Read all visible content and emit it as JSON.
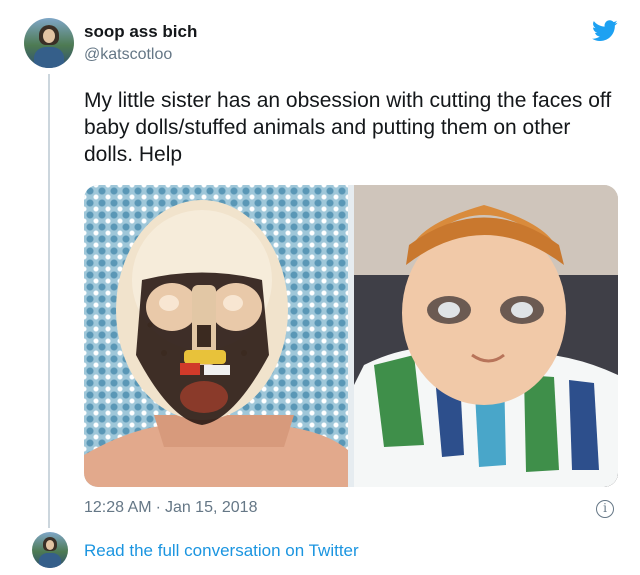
{
  "tweet": {
    "author": {
      "display_name": "soop ass bich",
      "handle": "@katscotloo",
      "avatar_icon": "user-avatar"
    },
    "text": "My little sister has an obsession with cutting the faces off baby dolls/stuffed animals and putting them on other dolls. Help",
    "media": [
      {
        "alt": "Doll head with its face cut out, revealing eyes and mechanism"
      },
      {
        "alt": "Doll wearing a face cut from another doll"
      }
    ],
    "time": "12:28 AM",
    "date": "Jan 15, 2018",
    "separator": "·",
    "logo_icon": "twitter-bird-icon",
    "info_icon": "info-icon"
  },
  "footer": {
    "link_text": "Read the full conversation on Twitter"
  },
  "colors": {
    "link": "#1b95e0",
    "secondary_text": "#657786",
    "brand": "#1da1f2"
  }
}
